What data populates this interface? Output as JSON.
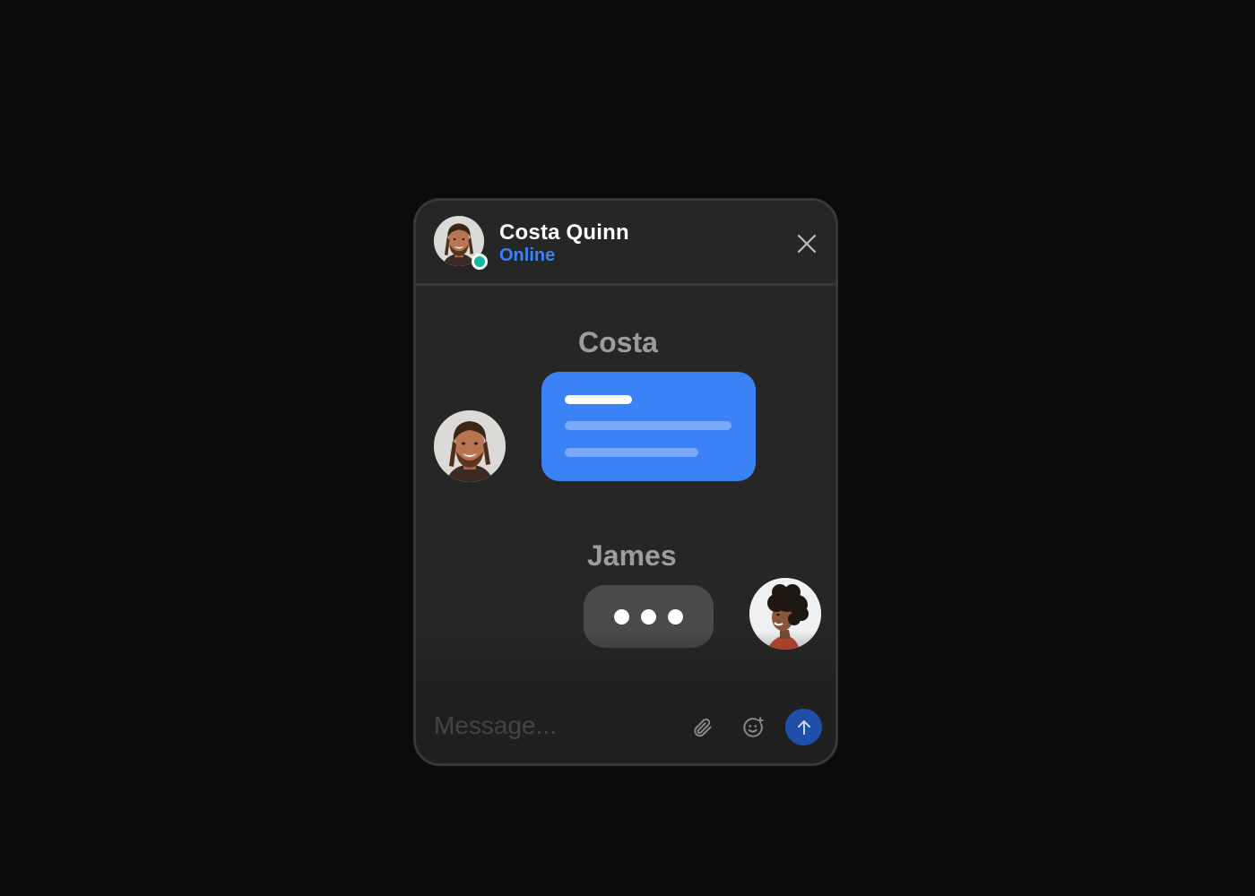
{
  "header": {
    "contact_name": "Costa Quinn",
    "status": "Online",
    "avatar_icon": "avatar-costa",
    "close_icon": "close-icon"
  },
  "messages": [
    {
      "sender": "Costa",
      "avatar_icon": "avatar-costa",
      "bubble_color": "#3b82f6",
      "content": "placeholder-lines"
    },
    {
      "sender": "James",
      "avatar_icon": "avatar-james",
      "bubble_color": "#4a4a4a",
      "content": "typing-indicator"
    }
  ],
  "composer": {
    "placeholder": "Message...",
    "attach_icon": "paperclip-icon",
    "emoji_icon": "emoji-add-icon",
    "send_icon": "arrow-up-icon"
  },
  "colors": {
    "background": "#0b0b0b",
    "window": "#262626",
    "accent": "#3b82f6",
    "online": "#14b89a",
    "send_button": "#1f4fa8"
  }
}
